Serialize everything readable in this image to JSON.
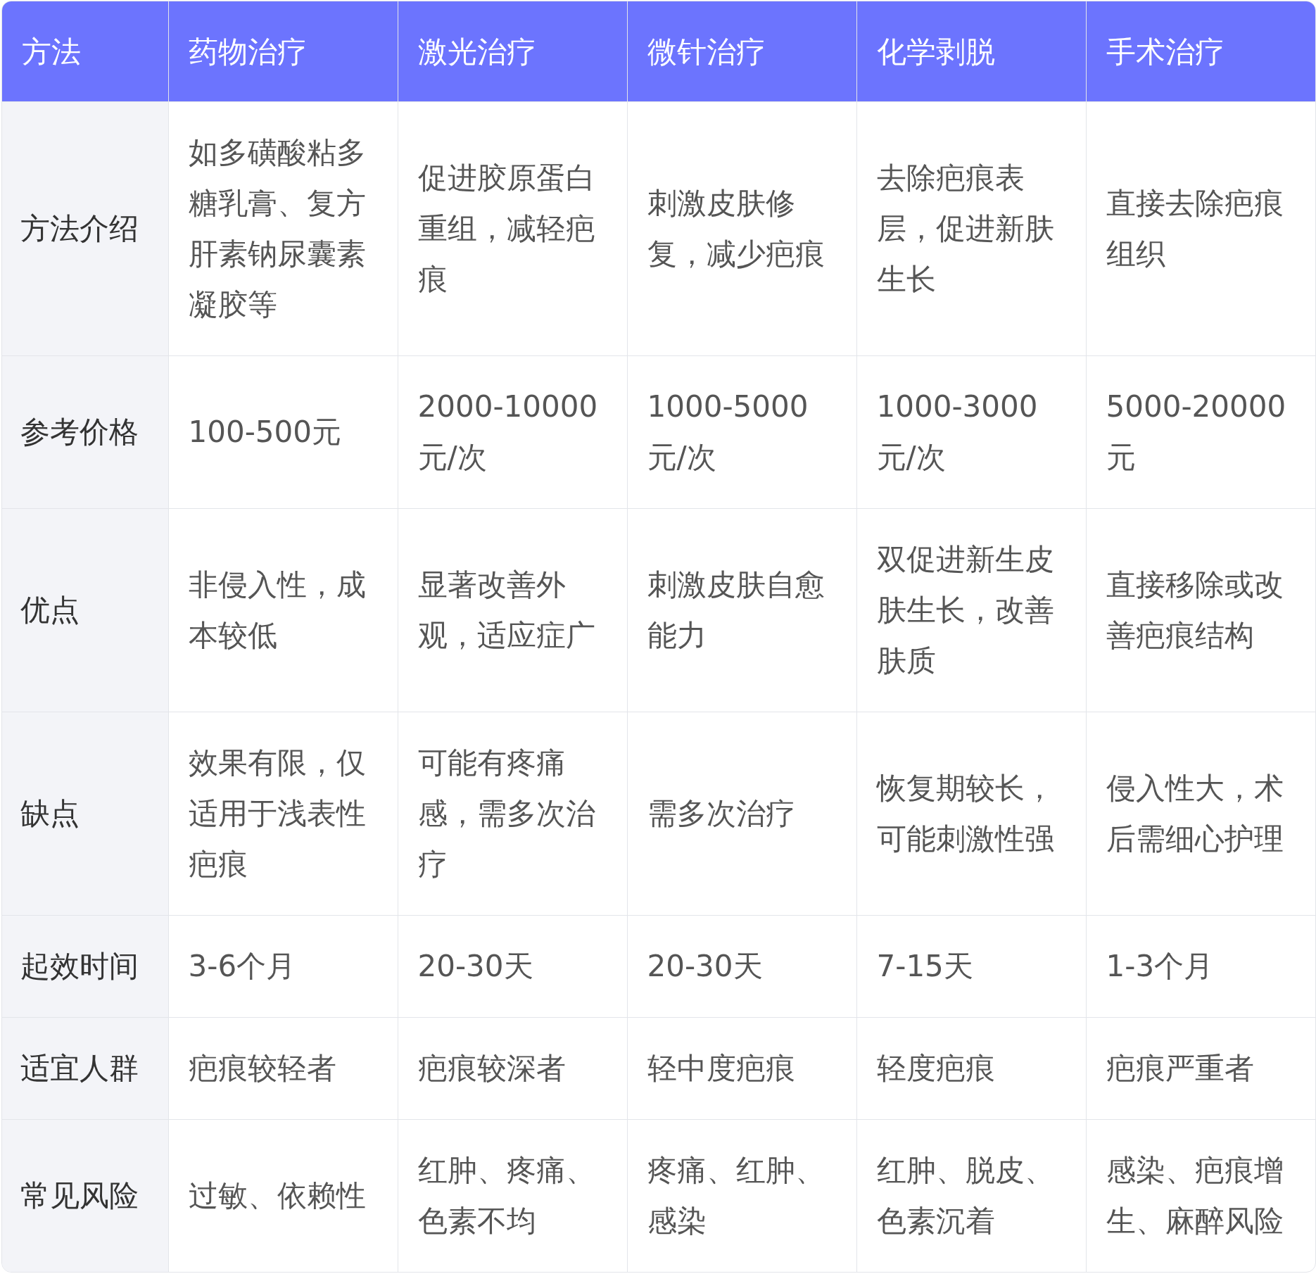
{
  "table": {
    "columns": [
      "方法",
      "药物治疗",
      "激光治疗",
      "微针治疗",
      "化学剥脱",
      "手术治疗"
    ],
    "rows": [
      {
        "cells": [
          "方法介绍",
          "如多磺酸粘多糖乳膏、复方肝素钠尿囊素凝胶等",
          "促进胶原蛋白重组，减轻疤痕",
          "刺激皮肤修复，减少疤痕",
          "去除疤痕表层，促进新肤生长",
          "直接去除疤痕组织"
        ]
      },
      {
        "cells": [
          "参考价格",
          "100-500元",
          "2000-10000元/次",
          "1000-5000元/次",
          "1000-3000元/次",
          "5000-20000元"
        ]
      },
      {
        "cells": [
          "优点",
          "非侵入性，成本较低",
          "显著改善外观，适应症广",
          "刺激皮肤自愈能力",
          "双促进新生皮肤生长，改善肤质",
          "直接移除或改善疤痕结构"
        ]
      },
      {
        "cells": [
          "缺点",
          "效果有限，仅适用于浅表性疤痕",
          "可能有疼痛感，需多次治疗",
          "需多次治疗",
          "恢复期较长，可能刺激性强",
          "侵入性大，术后需细心护理"
        ]
      },
      {
        "cells": [
          "起效时间",
          "3-6个月",
          "20-30天",
          "20-30天",
          "7-15天",
          "1-3个月"
        ]
      },
      {
        "cells": [
          "适宜人群",
          "疤痕较轻者",
          "疤痕较深者",
          "轻中度疤痕",
          "轻度疤痕",
          "疤痕严重者"
        ]
      },
      {
        "cells": [
          "常见风险",
          "过敏、依赖性",
          "红肿、疼痛、色素不均",
          "疼痛、红肿、感染",
          "红肿、脱皮、色素沉着",
          "感染、疤痕增生、麻醉风险"
        ]
      }
    ]
  }
}
